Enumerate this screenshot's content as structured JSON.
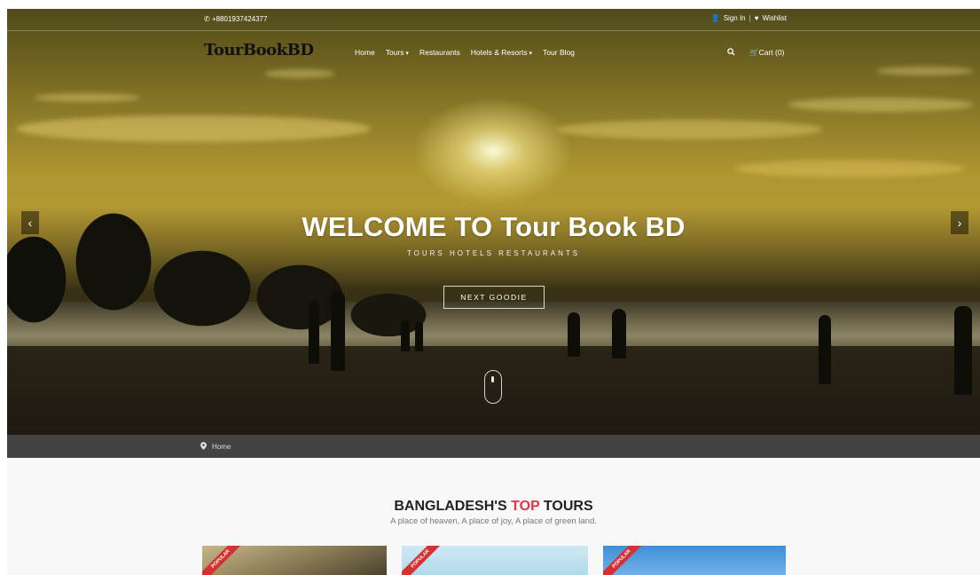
{
  "header": {
    "phone": "+8801937424377",
    "signin_label": "Sign In",
    "wishlist_label": "Wishlist",
    "logo": "TourBookBD"
  },
  "nav": {
    "items": [
      {
        "label": "Home",
        "dropdown": false
      },
      {
        "label": "Tours",
        "dropdown": true
      },
      {
        "label": "Restaurants",
        "dropdown": false
      },
      {
        "label": "Hotels & Resorts",
        "dropdown": true
      },
      {
        "label": "Tour Blog",
        "dropdown": false
      }
    ],
    "cart_label": "Cart (0)"
  },
  "hero": {
    "title": "WELCOME TO Tour Book BD",
    "subtitle": "TOURS HOTELS RESTAURANTS",
    "cta_label": "NEXT GOODIE",
    "prev_glyph": "‹",
    "next_glyph": "›"
  },
  "breadcrumb": {
    "label": "Home"
  },
  "section": {
    "title_part1": "BANGLADESH'S ",
    "title_accent": "TOP",
    "title_part2": " TOURS",
    "subtitle": "A place of heaven, A place of joy, A place of green land."
  },
  "cards": [
    {
      "badge": "POPULAR"
    },
    {
      "badge": "POPULAR"
    },
    {
      "badge": "POPULAR"
    }
  ],
  "icons": {
    "phone": "phone-icon",
    "user": "user-icon",
    "heart": "heart-icon",
    "search": "search-icon",
    "cart": "cart-icon",
    "location": "map-pin-icon"
  },
  "colors": {
    "accent": "#e8304a",
    "breadcrumb_bg": "#434343",
    "ribbon": "#d63030"
  }
}
